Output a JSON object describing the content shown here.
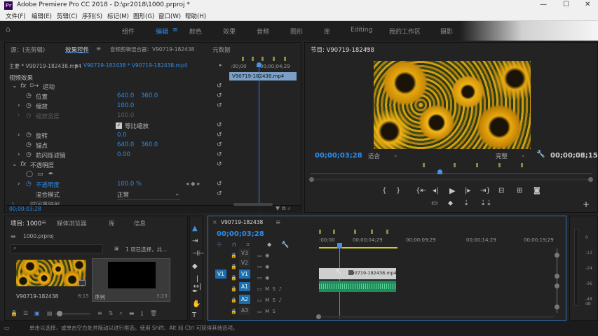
{
  "window": {
    "title": "Adobe Premiere Pro CC 2018 - D:\\pr2018\\1000.prproj *",
    "controls": [
      "—",
      "☐",
      "✕"
    ]
  },
  "menu": [
    "文件(F)",
    "编辑(E)",
    "剪辑(C)",
    "序列(S)",
    "标记(M)",
    "图形(G)",
    "窗口(W)",
    "帮助(H)"
  ],
  "workspaces": [
    {
      "label": "组件",
      "active": false
    },
    {
      "label": "编辑",
      "active": true
    },
    {
      "label": "颜色",
      "active": false
    },
    {
      "label": "效果",
      "active": false
    },
    {
      "label": "音频",
      "active": false
    },
    {
      "label": "图形",
      "active": false
    },
    {
      "label": "库",
      "active": false
    },
    {
      "label": "Editing",
      "active": false
    },
    {
      "label": "我的工作区",
      "active": false
    },
    {
      "label": "摄影",
      "active": false
    }
  ],
  "effect_controls": {
    "tabs": [
      "源：(无剪辑)",
      "效果控件",
      "音频剪辑混合器：V90719-182438",
      "元数据"
    ],
    "master": "主要 * V90719-182438.mp4",
    "sequence": "V90719-182438 * V90719-182438.mp4",
    "ruler_start": ":00;00",
    "ruler_end": "00;00;04;29",
    "clip_label": "V90719-182438.mp4",
    "section_video": "视频效果",
    "motion": "运动",
    "rows": [
      {
        "label": "位置",
        "v1": "640.0",
        "v2": "360.0"
      },
      {
        "label": "缩放",
        "v1": "100.0",
        "v2": ""
      },
      {
        "label": "缩放宽度",
        "v1": "100.0",
        "v2": ""
      },
      {
        "label": "等比缩放",
        "v1": "",
        "v2": ""
      },
      {
        "label": "旋转",
        "v1": "0.0",
        "v2": ""
      },
      {
        "label": "锚点",
        "v1": "640.0",
        "v2": "360.0"
      },
      {
        "label": "防闪烁滤镜",
        "v1": "0.00",
        "v2": ""
      }
    ],
    "opacity": "不透明度",
    "opacity_label": "不透明度",
    "opacity_value": "100.0 %",
    "blend_label": "混合模式",
    "blend_value": "正常",
    "time_remap": "时间重映射",
    "timecode": "00;00;03;28"
  },
  "program": {
    "title": "节目: V90719-182438",
    "timecode": "00;00;03;28",
    "fit": "适合",
    "quality": "完整",
    "duration": "00;00;08;15"
  },
  "project": {
    "tabs": [
      "项目: 1000",
      "媒体浏览器",
      "库",
      "信息"
    ],
    "file": "1000.prproj",
    "selection": "1 项已选择，共...",
    "items": [
      {
        "name": "V90719-182438",
        "duration": "8;15"
      },
      {
        "name": "序列",
        "duration": "3;23"
      }
    ]
  },
  "timeline": {
    "tab": "V90719-182438",
    "timecode": "00;00;03;28",
    "ruler": [
      ":00;00",
      "00;00;04;29",
      "00;00;09;29",
      "00;00;14;29",
      "00;00;19;29"
    ],
    "tracks": [
      "V3",
      "V2",
      "V1",
      "A1",
      "A2",
      "A3"
    ],
    "source_patch": [
      "V1"
    ],
    "clip_label": "V90719-182438.mp4",
    "meter_scale": [
      "0",
      "-12",
      "-24",
      "-36",
      "-48",
      "dB"
    ]
  },
  "status": "单击以选择，或单击空白处并拖动以进行框选。使用 Shift、Alt 和 Ctrl 可获得其他选项。"
}
